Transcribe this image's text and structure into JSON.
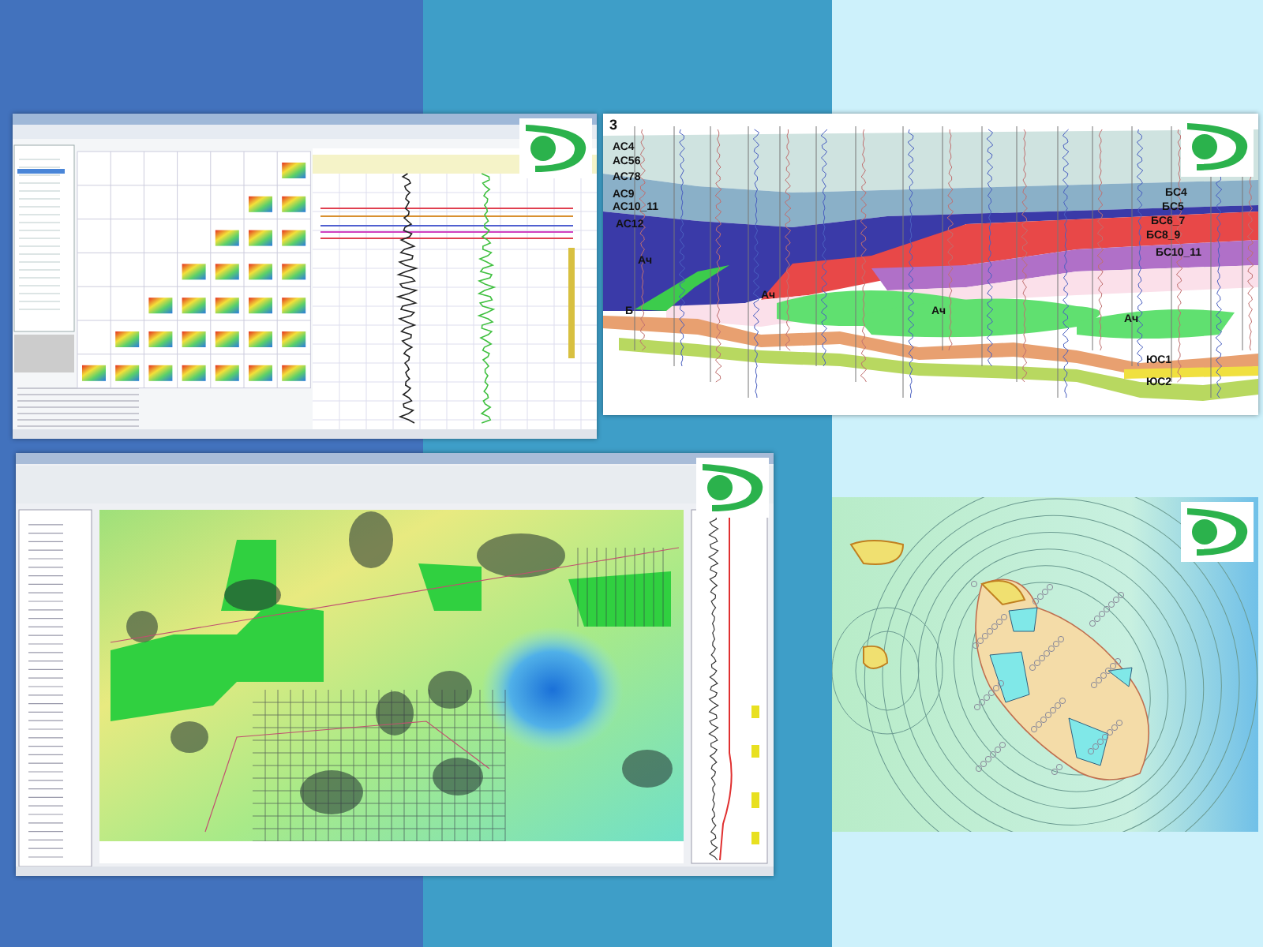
{
  "cross_section": {
    "number": "3",
    "labels": [
      {
        "text": "АС4"
      },
      {
        "text": "АС56"
      },
      {
        "text": "АС78"
      },
      {
        "text": "АС9"
      },
      {
        "text": "АС10_11"
      },
      {
        "text": "АС12"
      },
      {
        "text": "Ач"
      },
      {
        "text": "Б"
      },
      {
        "text": "Ач"
      },
      {
        "text": "Ач"
      },
      {
        "text": "Ач"
      },
      {
        "text": "БС4"
      },
      {
        "text": "БС5"
      },
      {
        "text": "БС6_7"
      },
      {
        "text": "БС8_9"
      },
      {
        "text": "БС10_11"
      },
      {
        "text": "ЮС1"
      },
      {
        "text": "ЮС2"
      }
    ]
  }
}
